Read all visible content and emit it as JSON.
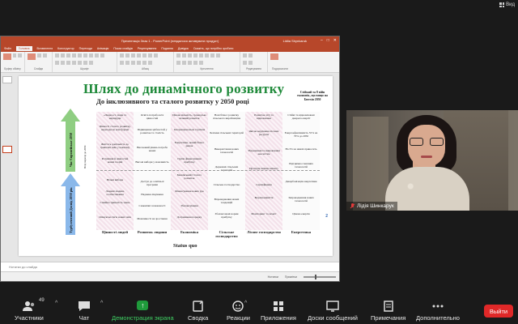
{
  "top": {
    "view_label": "Вид"
  },
  "powerpoint": {
    "title": "Презентація Знак 1 - PowerPoint (невдалося активувати продукт)",
    "user": "Lidiia Shynkaruk",
    "tabs": [
      "Файл",
      "Головна",
      "Вставлення",
      "Конструктор",
      "Переходи",
      "Анімація",
      "Показ слайдів",
      "Рецензування",
      "Подання",
      "Довідка",
      "Скажіть, що потрібно зробити"
    ],
    "ribbon_labels": [
      "Буфер обміну",
      "Слайди",
      "Шрифт",
      "Абзац",
      "Креслення",
      "Редагування",
      "Подорожчити"
    ],
    "notes_placeholder": "Нотатки до слайда",
    "status_notes": "Нотатки",
    "status_comments": "Примітки",
    "slide_number": "2"
  },
  "slide": {
    "title": "Шлях до динамічного розвитку",
    "subtitle": "До інклюзивного та сталого розвитку у 2050 році",
    "corner_note": "Стійкий та 8 війн економік, що вищо на Бютхія 2050",
    "arrow_labels": [
      "Час Європейське 2050",
      "Вхід перехід до 2050",
      "Турбулентний Досвід 2050 рік"
    ],
    "columns": [
      {
        "head": "Цінності людей",
        "cells": [
          "«Люди ест, люди та маршруди",
          "Цінності сталого розвитку, переходя на нові форми",
          "Життєсь доцільність до тривалих змін у кожному",
          "Розуміння й цінностей нових теорій",
          "Вільні вибори",
          "Людині людина особиставання",
          "Сімейна тривалість знань",
          "Опікуючи сім'ю нових змін"
        ]
      },
      {
        "head": "Розвиток людини",
        "cells": [
          "Освіта потреба всіх цінностей",
          "Підвищення здібностей у розвиток та сталість",
          "Високовий рівень потреба нових",
          "Високі вибори у можливість",
          "Доступ до освітньої програми",
          "Надання лікування",
          "Семенічні залежаності",
          "Можливості на зростання"
        ]
      },
      {
        "head": "Економіка",
        "cells": [
          "Цінова вільність, громадсько вільний розвиток",
          "Інтернаціональна торгівля",
          "Енергетика, новий бізнес ринок",
          "Групи фінансування прибутку",
          "Банківський Сталого розвиток",
          "Фінансування нових рук",
          "Збалансування",
          "Дотримання порядку"
        ]
      },
      {
        "head": "Сільське господарство",
        "cells": [
          "Нові бізнес розвитку сільського виробництва",
          "Безпеки сільських територій",
          "Використання нових технологій",
          "Державні сільських територій",
          "Сільське господарство",
          "Впровадження нових тенденцій",
          "Збалансовані норми прибутку"
        ]
      },
      {
        "head": "Лісове господарство",
        "cells": [
          "Розвиток лісу та відновлення",
          "Якісне керування лісових ресурсів",
          "Збереження та відновлення екосистем",
          "Протидія змінам клімату",
          "Сертифікація",
          "Біорізноманіття",
          "Моніторинг та захист"
        ]
      },
      {
        "head": "Енергетика",
        "cells": [
          "Стійкі та відновлювані джерела енергії",
          "Енергоефективність 55% на 70% до 2050",
          "На 3% на нижчі приносить",
          "Підтримка сонячних технологій",
          "Декарбонізація енергетики",
          "Запровадження нових технологій",
          "Цінова енергія"
        ]
      }
    ],
    "status_quo": "Status quo"
  },
  "participant": {
    "name": "Лідія Шинкарук"
  },
  "toolbar": {
    "participants_label": "Участники",
    "participants_count": "49",
    "chat_label": "Чат",
    "share_label": "Демонстрация экрана",
    "whiteboard_label": "Сводка",
    "reactions_label": "Реакции",
    "apps_label": "Приложения",
    "boards_label": "Доски сообщений",
    "notes_label": "Примечания",
    "more_label": "Дополнительно",
    "leave_label": "Выйти"
  }
}
